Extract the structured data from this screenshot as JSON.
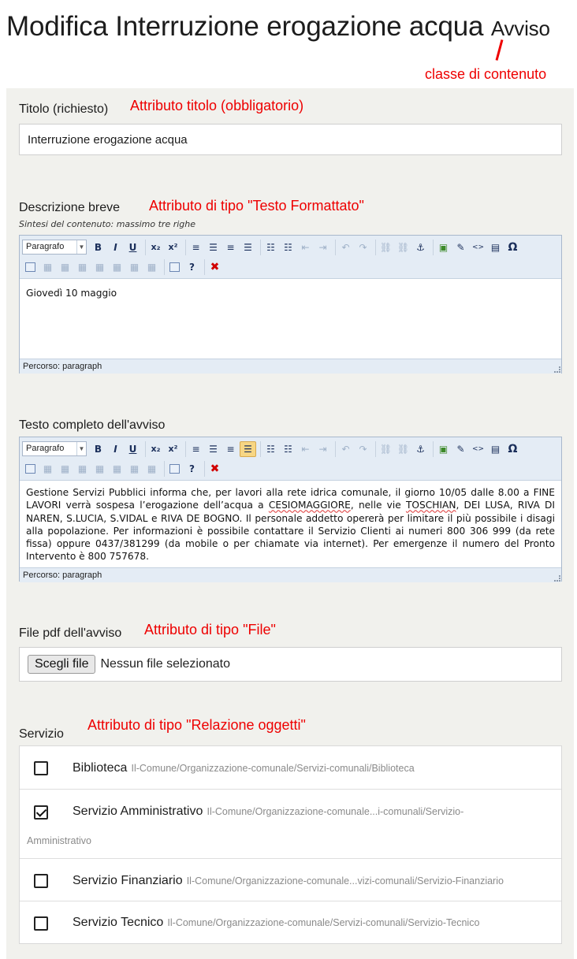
{
  "header": {
    "title": "Modifica Interruzione erogazione acqua",
    "class_name": "Avviso"
  },
  "annotations": {
    "class": "classe di contenuto",
    "title_attr": "Attributo titolo (obbligatorio)",
    "rich_text_attr": "Attributo di tipo \"Testo Formattato\"",
    "file_attr": "Attributo di tipo \"File\"",
    "relation_attr": "Attributo di tipo \"Relazione oggetti\""
  },
  "fields": {
    "title": {
      "label": "Titolo (richiesto)",
      "value": "Interruzione erogazione acqua"
    },
    "short_desc": {
      "label": "Descrizione breve",
      "help": "Sintesi del contenuto: massimo tre righe",
      "format": "Paragrafo",
      "content": "Giovedì 10 maggio",
      "status": "Percorso: paragraph"
    },
    "full_text": {
      "label": "Testo completo dell'avviso",
      "format": "Paragrafo",
      "content_parts": {
        "p1": "Gestione Servizi Pubblici informa che, per lavori alla rete idrica comunale, il giorno 10/05 dalle 8.00 a FINE LAVORI verrà sospesa l’erogazione dell’acqua a ",
        "w1": "CESIOMAGGIORE",
        "p2": ", nelle vie ",
        "w2": "TOSCHIAN",
        "p3": ", DEI LUSA, RIVA DI NAREN, S.LUCIA, S.VIDAL e RIVA DE BOGNO. Il personale addetto opererà per limitare il più possibile i disagi alla popolazione. Per informazioni è possibile contattare il Servizio Clienti ai numeri 800 306 999 (da rete fissa) oppure 0437/381299 (da mobile o per chiamate via internet). Per emergenze il numero del Pronto Intervento è 800 757678."
      },
      "status": "Percorso: paragraph"
    },
    "pdf": {
      "label": "File pdf dell'avviso",
      "button": "Scegli file",
      "status": "Nessun file selezionato"
    },
    "service": {
      "label": "Servizio",
      "options": [
        {
          "name": "Biblioteca",
          "path": "Il-Comune/Organizzazione-comunale/Servizi-comunali/Biblioteca",
          "checked": false
        },
        {
          "name": "Servizio Amministrativo",
          "path": "Il-Comune/Organizzazione-comunale...i-comunali/Servizio-",
          "path2": "Amministrativo",
          "checked": true
        },
        {
          "name": "Servizio Finanziario",
          "path": "Il-Comune/Organizzazione-comunale...vizi-comunali/Servizio-Finanziario",
          "checked": false
        },
        {
          "name": "Servizio Tecnico",
          "path": "Il-Comune/Organizzazione-comunale/Servizi-comunali/Servizio-Tecnico",
          "checked": false
        }
      ]
    }
  },
  "toolbar_icons": [
    "format-select",
    "bold-icon",
    "italic-icon",
    "underline-icon",
    "subscript-icon",
    "superscript-icon",
    "align-left-icon",
    "align-center-icon",
    "align-right-icon",
    "justify-icon",
    "bullet-list-icon",
    "numbered-list-icon",
    "outdent-icon",
    "indent-icon",
    "undo-icon",
    "redo-icon",
    "link-icon",
    "unlink-icon",
    "anchor-icon",
    "image-icon",
    "attachment-icon",
    "code-icon",
    "paste-text-icon",
    "special-char-icon",
    "table-icon",
    "delete-icon"
  ],
  "toolbar_glyphs": {
    "bold": "B",
    "italic": "I",
    "underline": "U",
    "subscript": "x₂",
    "superscript": "x²",
    "align_left": "≡",
    "align_center": "☰",
    "align_right": "≡",
    "justify": "☰",
    "bullets": "☷",
    "numbers": "☷",
    "outdent": "⇤",
    "indent": "⇥",
    "undo": "↶",
    "redo": "↷",
    "link": "⛓",
    "unlink": "⛓",
    "anchor": "⚓",
    "image": "▣",
    "attach": "✎",
    "code": "<>",
    "paste": "▤",
    "omega": "Ω",
    "help": "?",
    "delete": "✖",
    "dropdown": "▼",
    "tool": "▦"
  },
  "colors": {
    "panel": "#f1f1ed",
    "annotation": "#ee0000",
    "toolbar": "#e4ecf5"
  }
}
